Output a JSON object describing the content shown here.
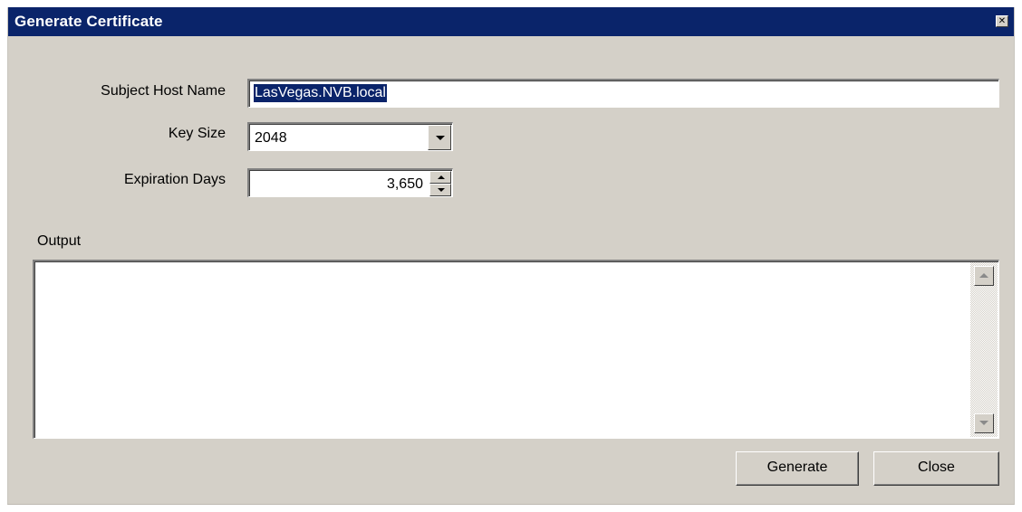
{
  "window": {
    "title": "Generate Certificate",
    "close_glyph": "✕",
    "titlebar_color": "#0a246a",
    "background_color": "#d4d0c8"
  },
  "form": {
    "subject_host_name": {
      "label": "Subject Host Name",
      "value": "LasVegas.NVB.local",
      "selected": true
    },
    "key_size": {
      "label": "Key Size",
      "value": "2048"
    },
    "expiration_days": {
      "label": "Expiration Days",
      "value": "3,650"
    }
  },
  "output": {
    "label": "Output",
    "value": ""
  },
  "buttons": {
    "generate": "Generate",
    "close": "Close"
  },
  "icons": {
    "close": "close-icon",
    "dropdown": "chevron-down-icon",
    "spin_up": "chevron-up-icon",
    "spin_down": "chevron-down-icon",
    "scroll_up": "scroll-up-arrow-icon",
    "scroll_down": "scroll-down-arrow-icon"
  }
}
